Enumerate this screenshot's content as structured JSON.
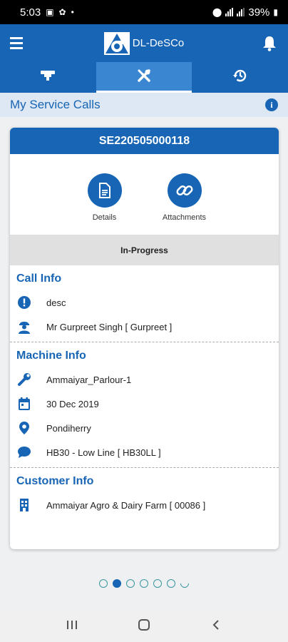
{
  "status_bar": {
    "time": "5:03",
    "battery": "39%"
  },
  "app": {
    "title": "DL-DeSCo"
  },
  "tabs": [
    {
      "name": "tab-machines",
      "icon": "cctv-icon",
      "active": false
    },
    {
      "name": "tab-service-calls",
      "icon": "tools-icon",
      "active": true
    },
    {
      "name": "tab-history",
      "icon": "history-icon",
      "active": false
    }
  ],
  "subheader": {
    "title": "My Service Calls"
  },
  "card": {
    "call_number": "SE220505000118",
    "actions": [
      {
        "label": "Details",
        "icon": "document-icon"
      },
      {
        "label": "Attachments",
        "icon": "link-icon"
      }
    ],
    "status": "In-Progress",
    "call_info": {
      "title": "Call Info",
      "description": "desc",
      "person": "Mr Gurpreet Singh [ Gurpreet ]"
    },
    "machine_info": {
      "title": "Machine Info",
      "machine": "Ammaiyar_Parlour-1",
      "date": "30 Dec 2019",
      "location": "Pondiherry",
      "model": "HB30 - Low Line [ HB30LL ]"
    },
    "customer_info": {
      "title": "Customer Info",
      "customer": "Ammaiyar Agro & Dairy Farm [ 00086 ]"
    }
  },
  "pager": {
    "total": 7,
    "current": 2
  },
  "colors": {
    "primary": "#1765b4",
    "active_tab": "#3a86d0",
    "subheader_bg": "#dde8f4"
  }
}
